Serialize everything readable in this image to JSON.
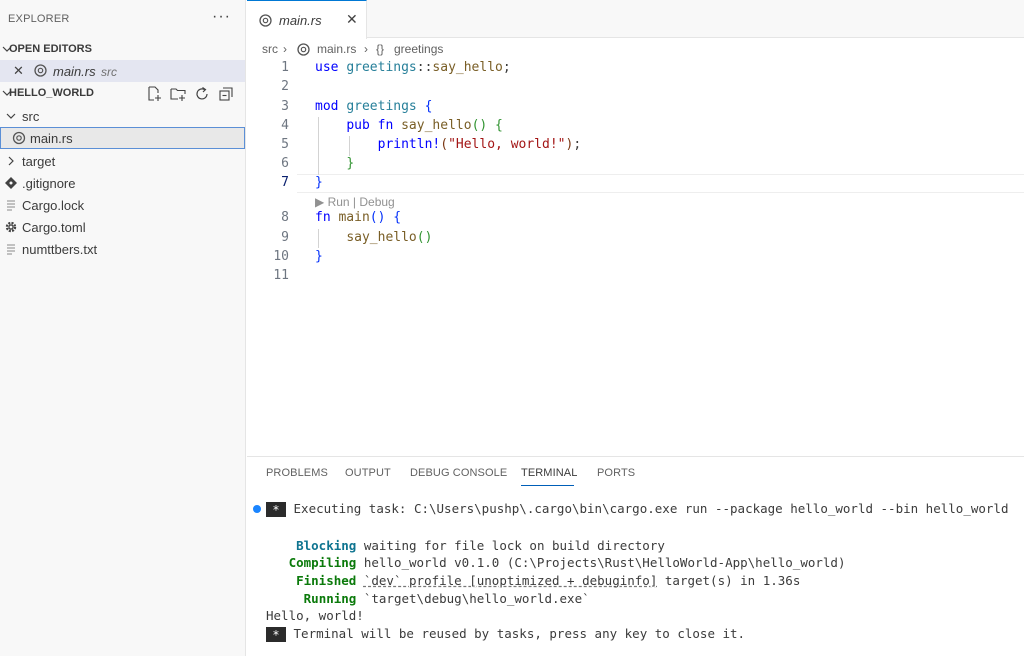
{
  "explorer": {
    "title": "EXPLORER",
    "more": "···",
    "open_editors": {
      "header": "OPEN EDITORS",
      "items": [
        {
          "close": "✕",
          "name": "main.rs",
          "dir": "src"
        }
      ]
    },
    "project": {
      "header": "HELLO_WORLD",
      "actions": [
        "new-file-icon",
        "new-folder-icon",
        "refresh-icon",
        "collapse-all-icon"
      ],
      "tree": [
        {
          "label": "src",
          "kind": "folder",
          "expanded": true
        },
        {
          "label": "main.rs",
          "kind": "rust-file",
          "selected": true
        },
        {
          "label": "target",
          "kind": "folder",
          "expanded": false
        },
        {
          "label": ".gitignore",
          "kind": "git-file"
        },
        {
          "label": "Cargo.lock",
          "kind": "text-file"
        },
        {
          "label": "Cargo.toml",
          "kind": "settings-file"
        },
        {
          "label": "numttbers.txt",
          "kind": "text-file"
        }
      ]
    }
  },
  "editor": {
    "tab": {
      "name": "main.rs",
      "close": "✕"
    },
    "breadcrumb": {
      "folder": "src",
      "sep": "›",
      "file": "main.rs",
      "symbol_icon": "{}",
      "symbol": "greetings"
    },
    "line_numbers": [
      "1",
      "2",
      "3",
      "4",
      "5",
      "6",
      "7",
      "8",
      "9",
      "10",
      "11"
    ],
    "active_line": "7",
    "codelens": "▶ Run | Debug",
    "code": {
      "l1": {
        "kw": "use",
        "ns": "greetings",
        "sep": "::",
        "fn": "say_hello",
        "end": ";"
      },
      "l3": {
        "kw": "mod",
        "ns": "greetings",
        "brace": "{"
      },
      "l4": {
        "kw1": "pub",
        "kw2": "fn",
        "fn": "say_hello",
        "paren": "()",
        "brace": "{"
      },
      "l5": {
        "mac": "println!",
        "open": "(",
        "str": "\"Hello, world!\"",
        "close": ")",
        "end": ";"
      },
      "l6": {
        "brace": "}"
      },
      "l7": {
        "brace": "}"
      },
      "l8": {
        "kw": "fn",
        "fn": "main",
        "paren": "()",
        "brace": "{"
      },
      "l9": {
        "fn": "say_hello",
        "paren": "()"
      },
      "l10": {
        "brace": "}"
      }
    }
  },
  "panel": {
    "tabs": [
      "PROBLEMS",
      "OUTPUT",
      "DEBUG CONSOLE",
      "TERMINAL",
      "PORTS"
    ],
    "active_tab": "TERMINAL",
    "terminal": {
      "star": "*",
      "task": "Executing task: C:\\Users\\pushp\\.cargo\\bin\\cargo.exe run --package hello_world --bin hello_world",
      "blocking_word": "Blocking",
      "blocking_text": "waiting for file lock on build directory",
      "compiling_word": "Compiling",
      "compiling_text": "hello_world v0.1.0 (C:\\Projects\\Rust\\HelloWorld-App\\hello_world)",
      "finished_word": "Finished",
      "finished_profile": "`dev` profile [unoptimized + debuginfo]",
      "finished_text": "target(s) in 1.36s",
      "running_word": "Running",
      "running_text": "`target\\debug\\hello_world.exe`",
      "output": "Hello, world!",
      "reuse": "Terminal will be reused by tasks, press any key to close it."
    }
  }
}
